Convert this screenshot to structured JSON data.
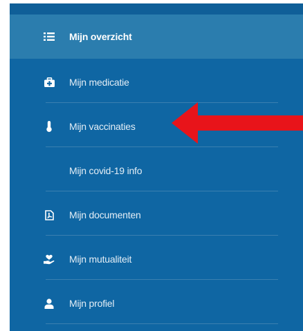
{
  "menu": {
    "items": [
      {
        "label": "Mijn overzicht",
        "icon": "list-icon",
        "active": true
      },
      {
        "label": "Mijn medicatie",
        "icon": "medical-kit-icon",
        "active": false
      },
      {
        "label": "Mijn vaccinaties",
        "icon": "thermometer-icon",
        "active": false
      },
      {
        "label": "Mijn covid-19 info",
        "icon": "",
        "active": false
      },
      {
        "label": "Mijn documenten",
        "icon": "pdf-document-icon",
        "active": false
      },
      {
        "label": "Mijn mutualiteit",
        "icon": "hand-heart-icon",
        "active": false
      },
      {
        "label": "Mijn profiel",
        "icon": "user-icon",
        "active": false
      }
    ]
  },
  "colors": {
    "panel_bg": "#0f66a3",
    "active_bg": "#2b7dae",
    "arrow": "#e8141a",
    "text": "#e4eef6"
  }
}
